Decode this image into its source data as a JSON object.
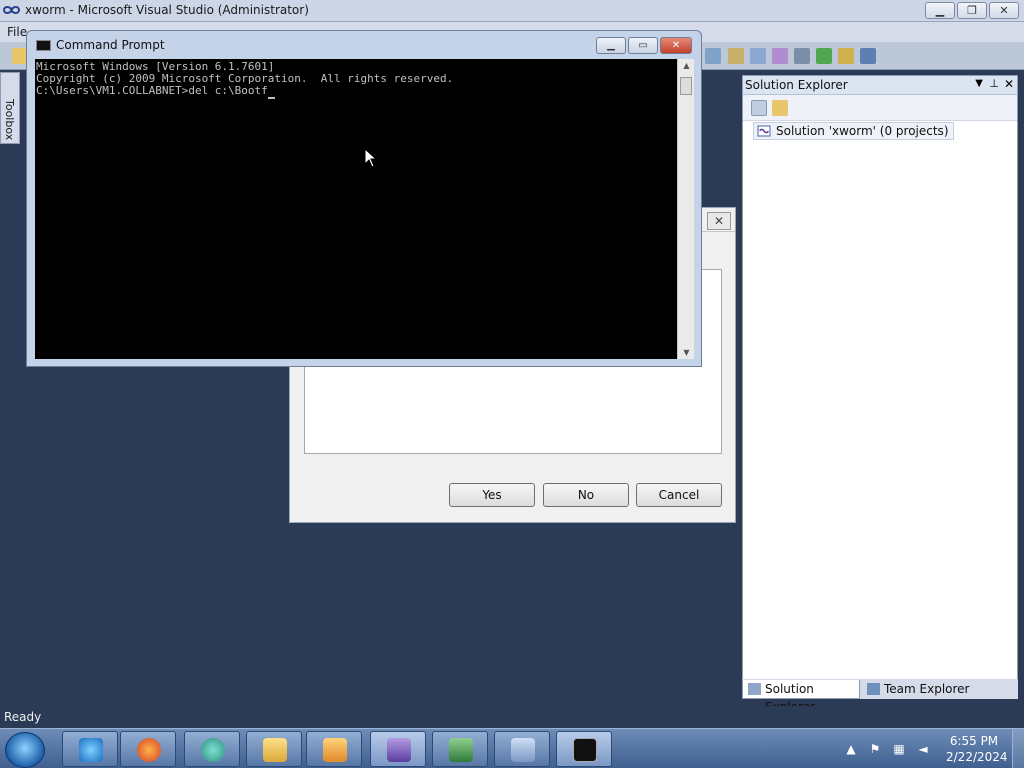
{
  "vs": {
    "title": "xworm - Microsoft Visual Studio (Administrator)",
    "menu_first": "File",
    "toolbox_label": "Toolbox",
    "status": "Ready"
  },
  "solution_explorer": {
    "title": "Solution Explorer",
    "root_item": "Solution 'xworm' (0 projects)",
    "tabs": [
      {
        "label": "Solution Explorer",
        "icon": "solution-explorer-icon"
      },
      {
        "label": "Team Explorer",
        "icon": "team-explorer-icon"
      }
    ]
  },
  "dialog": {
    "buttons": {
      "yes": "Yes",
      "no": "No",
      "cancel": "Cancel"
    },
    "close_glyph": "✕"
  },
  "cmd": {
    "title": "Command Prompt",
    "lines": [
      "Microsoft Windows [Version 6.1.7601]",
      "Copyright (c) 2009 Microsoft Corporation.  All rights reserved.",
      "",
      "C:\\Users\\VM1.COLLABNET>del c:\\Bootf"
    ]
  },
  "taskbar": {
    "apps": [
      "internet-explorer-icon",
      "firefox-icon",
      "chrome-icon",
      "file-explorer-icon",
      "media-player-icon",
      "visual-studio-icon",
      "task-manager-icon",
      "remote-desktop-icon",
      "command-prompt-icon"
    ],
    "time": "6:55 PM",
    "date": "2/22/2024"
  },
  "colors": {
    "desktop": "#2b3a55",
    "console_bg": "#000000",
    "console_fg": "#c0c0c0"
  }
}
